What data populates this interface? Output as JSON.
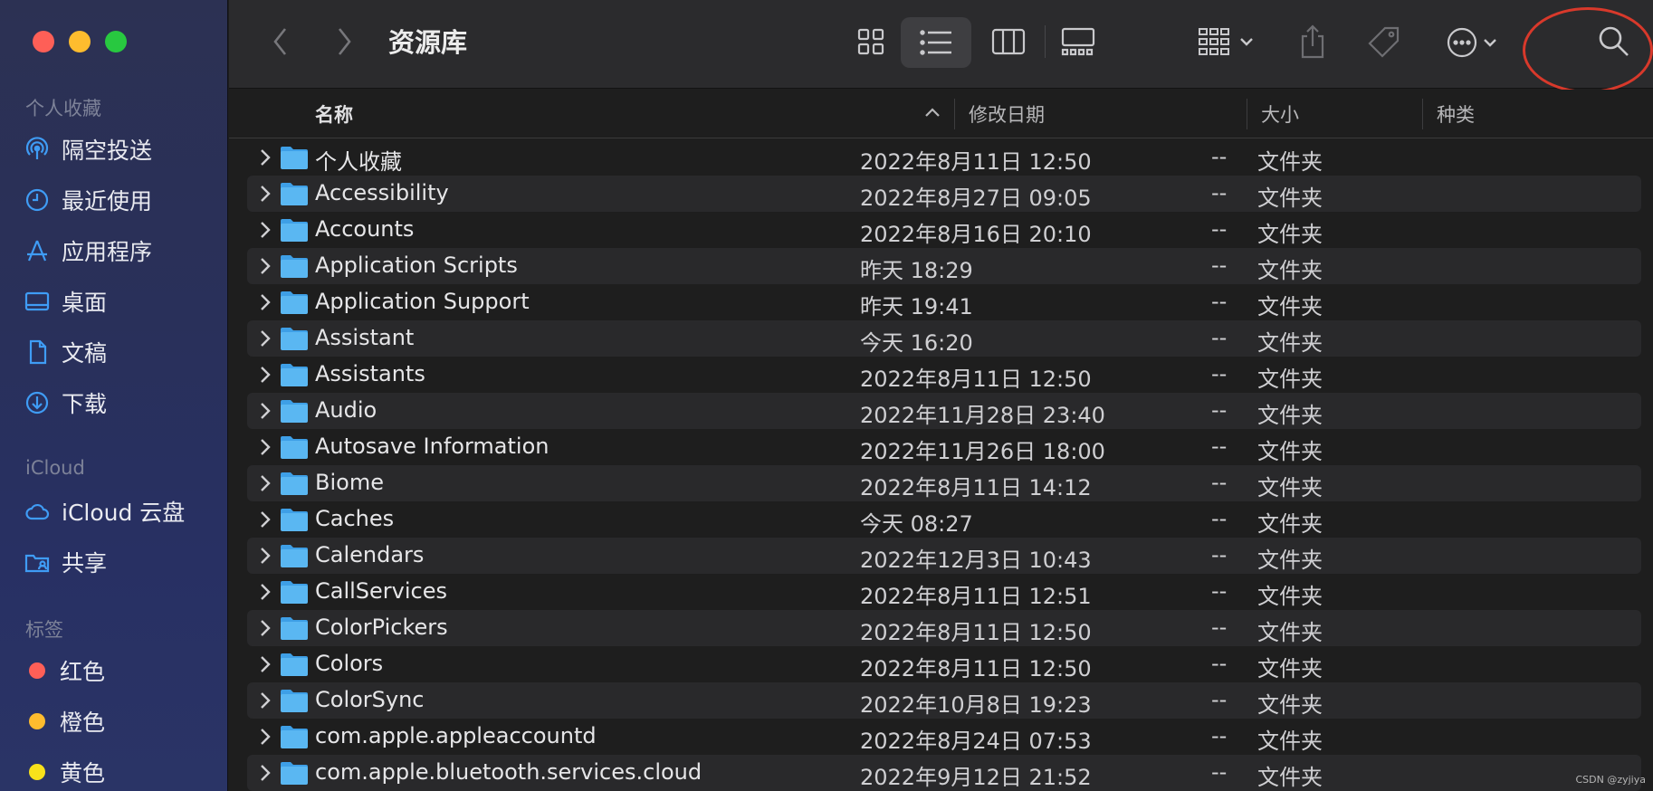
{
  "window": {
    "title": "资源库"
  },
  "colors": {
    "folder_blue": "#5ab7f2",
    "accent": "#3f9cf5",
    "annotation_red": "#d8392b"
  },
  "sidebar": {
    "favorites_header": "个人收藏",
    "favorites": [
      {
        "label": "隔空投送",
        "icon": "airdrop-icon"
      },
      {
        "label": "最近使用",
        "icon": "clock-icon"
      },
      {
        "label": "应用程序",
        "icon": "applications-icon"
      },
      {
        "label": "桌面",
        "icon": "desktop-icon"
      },
      {
        "label": "文稿",
        "icon": "document-icon"
      },
      {
        "label": "下载",
        "icon": "download-icon"
      }
    ],
    "icloud_header": "iCloud",
    "icloud": [
      {
        "label": "iCloud 云盘",
        "icon": "cloud-icon"
      },
      {
        "label": "共享",
        "icon": "shared-folder-icon"
      }
    ],
    "tags_header": "标签",
    "tags": [
      {
        "label": "红色",
        "color": "#fe5f57"
      },
      {
        "label": "橙色",
        "color": "#febc2e"
      },
      {
        "label": "黄色",
        "color": "#f8e11b"
      }
    ]
  },
  "toolbar": {
    "icons": [
      "back-icon",
      "forward-icon",
      "icon-view-icon",
      "list-view-icon",
      "column-view-icon",
      "gallery-view-icon",
      "group-icon",
      "share-icon",
      "tag-icon",
      "more-icon",
      "search-icon"
    ],
    "selected_view": "list-view"
  },
  "columns": {
    "name": "名称",
    "modified": "修改日期",
    "size": "大小",
    "kind": "种类"
  },
  "files": [
    {
      "name": "个人收藏",
      "modified": "2022年8月11日 12:50",
      "size": "--",
      "kind": "文件夹"
    },
    {
      "name": "Accessibility",
      "modified": "2022年8月27日 09:05",
      "size": "--",
      "kind": "文件夹"
    },
    {
      "name": "Accounts",
      "modified": "2022年8月16日 20:10",
      "size": "--",
      "kind": "文件夹"
    },
    {
      "name": "Application Scripts",
      "modified": "昨天 18:29",
      "size": "--",
      "kind": "文件夹"
    },
    {
      "name": "Application Support",
      "modified": "昨天 19:41",
      "size": "--",
      "kind": "文件夹"
    },
    {
      "name": "Assistant",
      "modified": "今天 16:20",
      "size": "--",
      "kind": "文件夹"
    },
    {
      "name": "Assistants",
      "modified": "2022年8月11日 12:50",
      "size": "--",
      "kind": "文件夹"
    },
    {
      "name": "Audio",
      "modified": "2022年11月28日 23:40",
      "size": "--",
      "kind": "文件夹"
    },
    {
      "name": "Autosave Information",
      "modified": "2022年11月26日 18:00",
      "size": "--",
      "kind": "文件夹"
    },
    {
      "name": "Biome",
      "modified": "2022年8月11日 14:12",
      "size": "--",
      "kind": "文件夹"
    },
    {
      "name": "Caches",
      "modified": "今天 08:27",
      "size": "--",
      "kind": "文件夹"
    },
    {
      "name": "Calendars",
      "modified": "2022年12月3日 10:43",
      "size": "--",
      "kind": "文件夹"
    },
    {
      "name": "CallServices",
      "modified": "2022年8月11日 12:51",
      "size": "--",
      "kind": "文件夹"
    },
    {
      "name": "ColorPickers",
      "modified": "2022年8月11日 12:50",
      "size": "--",
      "kind": "文件夹"
    },
    {
      "name": "Colors",
      "modified": "2022年8月11日 12:50",
      "size": "--",
      "kind": "文件夹"
    },
    {
      "name": "ColorSync",
      "modified": "2022年10月8日 19:23",
      "size": "--",
      "kind": "文件夹"
    },
    {
      "name": "com.apple.appleaccountd",
      "modified": "2022年8月24日 07:53",
      "size": "--",
      "kind": "文件夹"
    },
    {
      "name": "com.apple.bluetooth.services.cloud",
      "modified": "2022年9月12日 21:52",
      "size": "--",
      "kind": "文件夹"
    }
  ],
  "watermark": "CSDN @zyjiya"
}
